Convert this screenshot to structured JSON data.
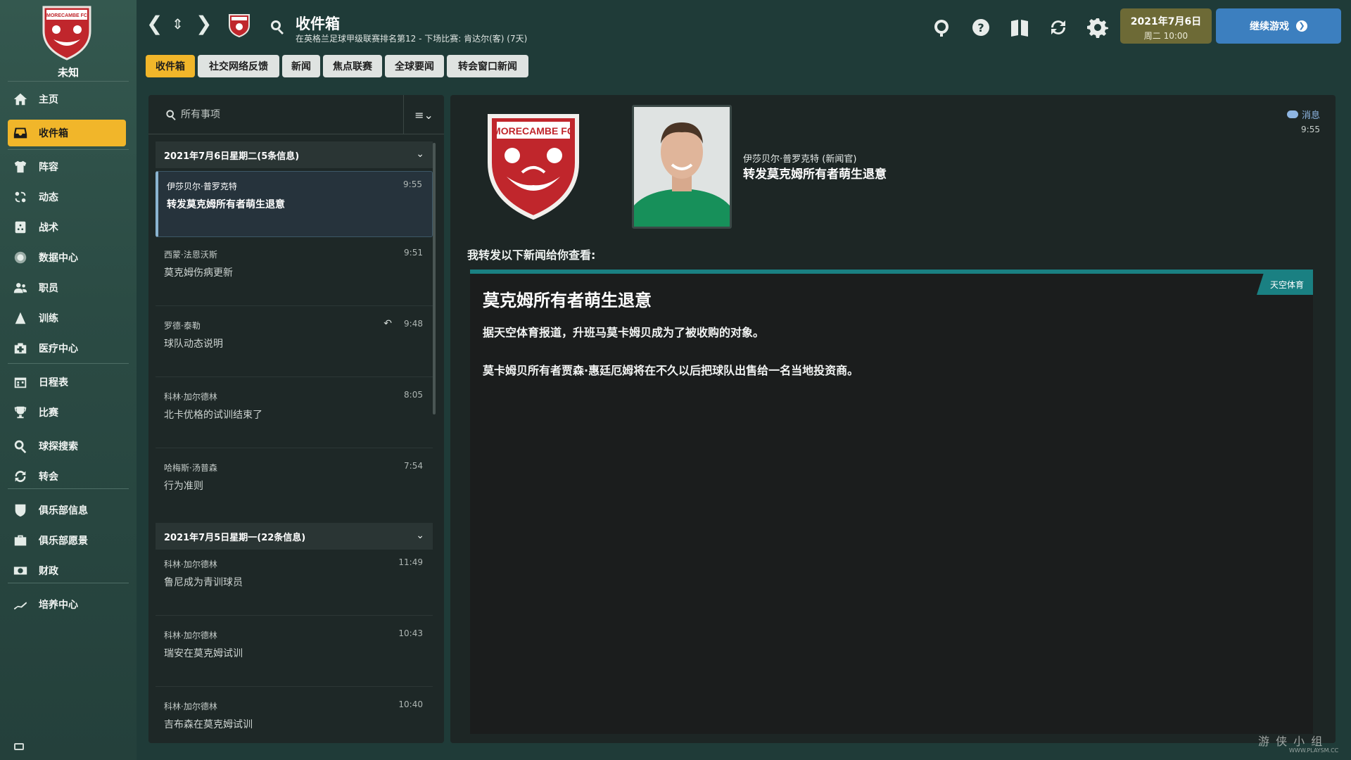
{
  "club": {
    "name": "未知",
    "crest_text": "MORECAMBE FC"
  },
  "sidebar": {
    "items": [
      {
        "label": "主页",
        "icon": "home-icon"
      },
      {
        "label": "收件箱",
        "icon": "inbox-icon",
        "active": true
      },
      {
        "label": "阵容",
        "icon": "shirt-icon"
      },
      {
        "label": "动态",
        "icon": "dynamics-icon"
      },
      {
        "label": "战术",
        "icon": "tactics-icon"
      },
      {
        "label": "数据中心",
        "icon": "data-hub-icon"
      },
      {
        "label": "职员",
        "icon": "staff-icon"
      },
      {
        "label": "训练",
        "icon": "training-icon"
      },
      {
        "label": "医疗中心",
        "icon": "medical-icon"
      },
      {
        "label": "日程表",
        "icon": "calendar-icon"
      },
      {
        "label": "比赛",
        "icon": "trophy-icon"
      },
      {
        "label": "球探搜索",
        "icon": "scouting-icon"
      },
      {
        "label": "转会",
        "icon": "transfers-icon"
      },
      {
        "label": "俱乐部信息",
        "icon": "club-info-icon"
      },
      {
        "label": "俱乐部愿景",
        "icon": "club-vision-icon"
      },
      {
        "label": "财政",
        "icon": "finances-icon"
      },
      {
        "label": "培养中心",
        "icon": "development-icon"
      }
    ]
  },
  "header": {
    "title": "收件箱",
    "subtitle": "在英格兰足球甲级联赛排名第12 - 下场比赛: 肯达尔(客) (7天)",
    "date_line1": "2021年7月6日",
    "date_line2": "周二 10:00",
    "continue_label": "继续游戏",
    "icons": [
      "globe-icon",
      "help-icon",
      "manual-icon",
      "refresh-icon",
      "settings-icon"
    ]
  },
  "tabs": [
    "收件箱",
    "社交网络反馈",
    "新闻",
    "焦点联赛",
    "全球要闻",
    "转会窗口新闻"
  ],
  "inbox": {
    "search_placeholder": "所有事项",
    "groups": [
      {
        "header": "2021年7月6日星期二(5条信息)",
        "messages": [
          {
            "sender": "伊莎贝尔·普罗克特",
            "time": "9:55",
            "subject": "转发莫克姆所有者萌生退意",
            "selected": true
          },
          {
            "sender": "西蒙·法恩沃斯",
            "time": "9:51",
            "subject": "莫克姆伤病更新"
          },
          {
            "sender": "罗德·泰勒",
            "time": "9:48",
            "subject": "球队动态说明",
            "replied": true
          },
          {
            "sender": "科林·加尔德林",
            "time": "8:05",
            "subject": "北卡优格的试训结束了"
          },
          {
            "sender": "哈梅斯·汤普森",
            "time": "7:54",
            "subject": "行为准则"
          }
        ]
      },
      {
        "header": "2021年7月5日星期一(22条信息)",
        "messages": [
          {
            "sender": "科林·加尔德林",
            "time": "11:49",
            "subject": "鲁尼成为青训球员"
          },
          {
            "sender": "科林·加尔德林",
            "time": "10:43",
            "subject": "瑞安在莫克姆试训"
          },
          {
            "sender": "科林·加尔德林",
            "time": "10:40",
            "subject": "吉布森在莫克姆试训"
          }
        ]
      }
    ]
  },
  "detail": {
    "sender": "伊莎贝尔·普罗克特 (新闻官)",
    "title": "转发莫克姆所有者萌生退意",
    "tag": "消息",
    "time": "9:55",
    "intro": "我转发以下新闻给你查看:",
    "article": {
      "source": "天空体育",
      "title": "莫克姆所有者萌生退意",
      "p1": "据天空体育报道，升班马莫卡姆贝成为了被收购的对象。",
      "p2": "莫卡姆贝所有者贾森·惠廷厄姆将在不久以后把球队出售给一名当地投资商。"
    }
  },
  "watermark": {
    "main": "游 侠 小 组",
    "sub": "WWW.PLAYSM.CC"
  },
  "colors": {
    "accent": "#f1b62a",
    "continue_button": "#3c7fbf",
    "date_box": "#6d6a36",
    "article_bar": "#1a8082"
  }
}
